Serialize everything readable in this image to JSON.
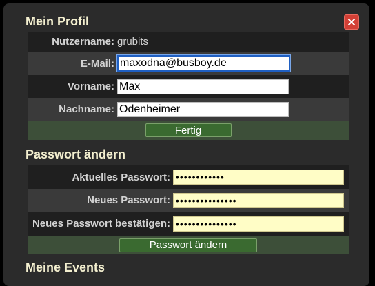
{
  "profile": {
    "title": "Mein Profil",
    "close_icon": "close-icon",
    "username_label": "Nutzername:",
    "username_value": "grubits",
    "email_label": "E-Mail:",
    "email_value": "maxodna@busboy.de",
    "firstname_label": "Vorname:",
    "firstname_value": "Max",
    "lastname_label": "Nachname:",
    "lastname_value": "Odenheimer",
    "done_button": "Fertig"
  },
  "password": {
    "title": "Passwort ändern",
    "current_label": "Aktuelles Passwort:",
    "current_value": "••••••••••••",
    "new_label": "Neues Passwort:",
    "new_value": "•••••••••••••••",
    "confirm_label": "Neues Passwort bestätigen:",
    "confirm_value": "•••••••••••••••",
    "submit_button": "Passwort ändern"
  },
  "events": {
    "title": "Meine Events"
  },
  "colors": {
    "dialog_bg": "#2b2b2b",
    "heading": "#f3efcf",
    "close_button": "#d24036",
    "action_row": "#3d4f39",
    "button_green": "#3a6a30",
    "password_field": "#fffdc6"
  }
}
